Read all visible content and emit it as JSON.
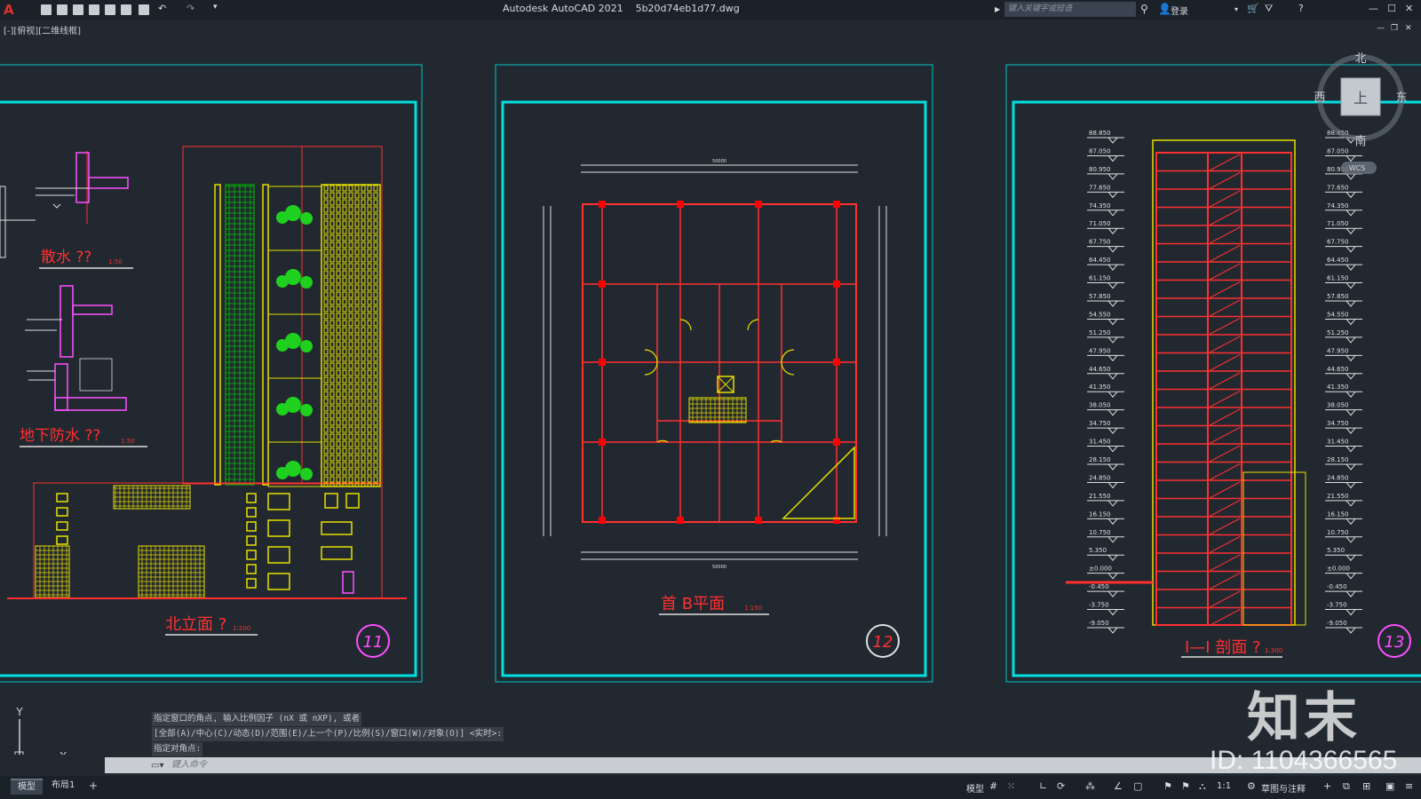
{
  "app": {
    "title": "Autodesk AutoCAD 2021    5b20d74eb1d77.dwg",
    "search_placeholder": "键入关键字或短语",
    "login_label": "登录"
  },
  "viewport": {
    "label": "[-][俯视][二维线框]"
  },
  "viewcube": {
    "north": "北",
    "south": "南",
    "east": "东",
    "west": "西",
    "top_face": "上",
    "wcs": "WCS"
  },
  "sheets": {
    "sheet1": {
      "detail1_title": "散水 ??",
      "detail1_scale": "1:50",
      "detail2_title": "地下防水 ??",
      "detail2_scale": "1:50",
      "title": "北立面 ?",
      "scale": "1:200",
      "number": "11"
    },
    "sheet2": {
      "title": "首 B平面",
      "scale": "1:150",
      "number": "12",
      "dim_total": "50000"
    },
    "sheet3": {
      "title": "I—I 剖面 ?",
      "scale": "1:300",
      "number": "13",
      "elevations": [
        "88.850",
        "87.050",
        "80.950",
        "77.650",
        "74.350",
        "71.050",
        "67.750",
        "64.450",
        "61.150",
        "57.850",
        "54.550",
        "51.250",
        "47.950",
        "44.650",
        "41.350",
        "38.050",
        "34.750",
        "31.450",
        "28.150",
        "24.850",
        "21.550",
        "16.150",
        "10.750",
        "5.350",
        "±0.000",
        "-0.450",
        "-3.750",
        "-9.050"
      ]
    }
  },
  "command": {
    "history": [
      "指定窗口的角点, 输入比例因子 (nX 或 nXP), 或者",
      "[全部(A)/中心(C)/动态(D)/范围(E)/上一个(P)/比例(S)/窗口(W)/对象(O)] <实时>:",
      "指定对角点:"
    ],
    "input_placeholder": "键入命令"
  },
  "status": {
    "tab_model": "模型",
    "tab_layout1": "布局1",
    "tab_add": "+",
    "model_label": "模型",
    "scale_label": "1:1",
    "workspace_label": "草图与注释"
  },
  "ucs": {
    "x": "X",
    "y": "Y"
  },
  "watermark": {
    "logo": "知末",
    "id": "ID: 1104366565"
  }
}
